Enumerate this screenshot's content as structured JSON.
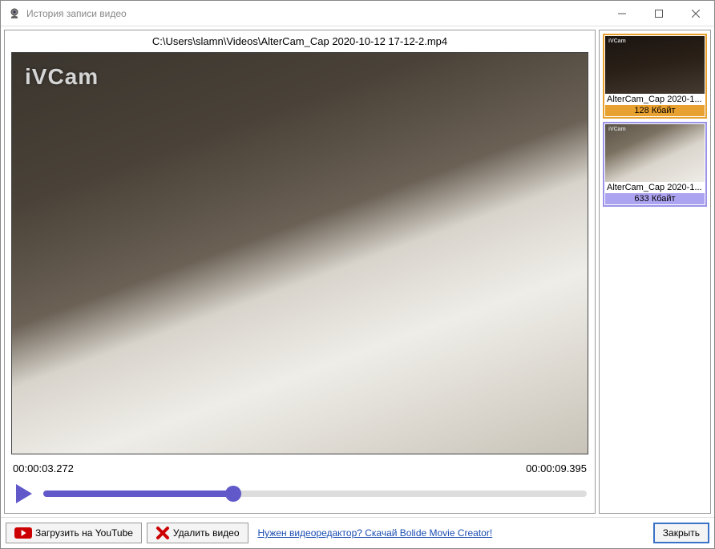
{
  "window": {
    "title": "История записи видео"
  },
  "filepath": "C:\\Users\\slamn\\Videos\\AlterCam_Cap 2020-10-12 17-12-2.mp4",
  "watermark": "iVCam",
  "time": {
    "current": "00:00:03.272",
    "total": "00:00:09.395",
    "progress_percent": 35
  },
  "thumbnails": [
    {
      "name": "AlterCam_Cap 2020-1...",
      "size": "128 Кбайт",
      "selected": true,
      "highlight": "orange",
      "style": "dark"
    },
    {
      "name": "AlterCam_Cap 2020-1...",
      "size": "633 Кбайт",
      "selected": true,
      "highlight": "blue",
      "style": "light"
    }
  ],
  "footer": {
    "upload_label": "Загрузить на YouTube",
    "delete_label": "Удалить видео",
    "editor_link": "Нужен видеоредактор? Скачай Bolide Movie Creator!",
    "close_label": "Закрыть"
  }
}
